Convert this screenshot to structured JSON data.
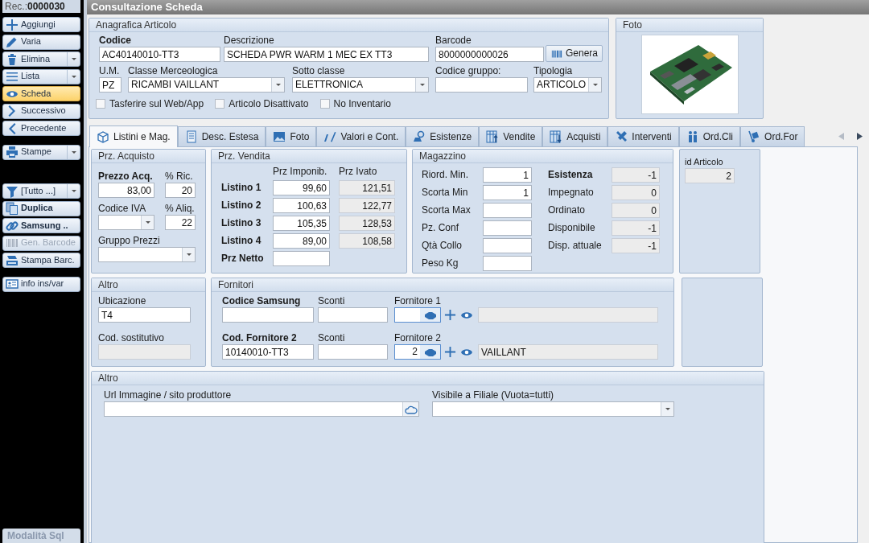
{
  "title": "Consultazione Scheda",
  "sidebar": {
    "record_label": "Rec.:",
    "record_number": "0000030",
    "groups": [
      [
        {
          "label": "Aggiungi",
          "kind": "button",
          "selected": false,
          "disabled": false,
          "bold": false
        },
        {
          "label": "Varia",
          "kind": "button",
          "selected": false,
          "disabled": false,
          "bold": false
        },
        {
          "label": "Elimina",
          "kind": "split",
          "selected": false,
          "disabled": false,
          "bold": false
        },
        {
          "label": "Lista",
          "kind": "split",
          "selected": false,
          "disabled": false,
          "bold": false
        },
        {
          "label": "Scheda",
          "kind": "button",
          "selected": true,
          "disabled": false,
          "bold": false
        },
        {
          "label": "Successivo",
          "kind": "button",
          "selected": false,
          "disabled": false,
          "bold": false
        },
        {
          "label": "Precedente",
          "kind": "button",
          "selected": false,
          "disabled": false,
          "bold": false
        }
      ],
      [
        {
          "label": "Stampe",
          "kind": "split",
          "selected": false,
          "disabled": false,
          "bold": false
        }
      ],
      [
        {
          "label": "[Tutto ...]",
          "kind": "split",
          "selected": false,
          "disabled": false,
          "bold": false
        },
        {
          "label": "Duplica",
          "kind": "button",
          "selected": false,
          "disabled": false,
          "bold": true
        },
        {
          "label": "Samsung ..",
          "kind": "button",
          "selected": false,
          "disabled": false,
          "bold": true
        },
        {
          "label": "Gen. Barcode",
          "kind": "button",
          "selected": false,
          "disabled": true,
          "bold": false
        },
        {
          "label": "Stampa Barc.",
          "kind": "button",
          "selected": false,
          "disabled": false,
          "bold": false
        }
      ],
      [
        {
          "label": "info ins/var",
          "kind": "button",
          "selected": false,
          "disabled": false,
          "bold": false
        }
      ]
    ],
    "mode_button": "Modalità Sql"
  },
  "anagrafica": {
    "title": "Anagrafica Articolo",
    "row1": [
      {
        "label": "Codice",
        "bold": true,
        "value": "AC40140010-TT3",
        "kind": "text"
      },
      {
        "label": "Descrizione",
        "bold": false,
        "value": "SCHEDA PWR WARM 1 MEC EX TT3",
        "kind": "text"
      },
      {
        "label": "Barcode",
        "bold": false,
        "value": "8000000000026",
        "kind": "text"
      }
    ],
    "generate_button": "Genera",
    "row2": [
      {
        "label": "U.M.",
        "bold": false,
        "value": "PZ",
        "kind": "text"
      },
      {
        "label": "Classe Merceologica",
        "bold": false,
        "value": "RICAMBI VAILLANT",
        "kind": "combo"
      },
      {
        "label": "Sotto classe",
        "bold": false,
        "value": "ELETTRONICA",
        "kind": "combo"
      },
      {
        "label": "Codice gruppo:",
        "bold": false,
        "kind": "text"
      },
      {
        "label": "Tipologia",
        "bold": false,
        "value": "ARTICOLO",
        "kind": "combo"
      }
    ],
    "checkboxes": [
      {
        "label": "Tasferire sul Web/App",
        "checked": false
      },
      {
        "label": "Articolo Disattivato",
        "checked": false
      },
      {
        "label": "No Inventario",
        "checked": false
      }
    ]
  },
  "foto": {
    "title": "Foto",
    "kind": "picture"
  },
  "tabs": [
    {
      "label": "Listini e Mag.",
      "selected": true
    },
    {
      "label": "Desc. Estesa",
      "selected": false
    },
    {
      "label": "Foto",
      "selected": false
    },
    {
      "label": "Valori e Cont.",
      "selected": false
    },
    {
      "label": "Esistenze",
      "selected": false
    },
    {
      "label": "Vendite",
      "selected": false
    },
    {
      "label": "Acquisti",
      "selected": false
    },
    {
      "label": "Interventi",
      "selected": false
    },
    {
      "label": "Ord.Cli",
      "selected": false
    },
    {
      "label": "Ord.For",
      "selected": false
    }
  ],
  "purchase": {
    "title": "Prz. Acquisto",
    "fields": [
      {
        "label": "Prezzo Acq.",
        "bold": true,
        "value": "83,00",
        "kind": "number"
      },
      {
        "label": "% Ric.",
        "bold": false,
        "value": "20",
        "kind": "number"
      },
      {
        "label": "Codice IVA",
        "bold": false,
        "kind": "combo"
      },
      {
        "label": "% Aliq.",
        "bold": false,
        "value": "22",
        "kind": "number"
      },
      {
        "label": "Gruppo Prezzi",
        "bold": false,
        "kind": "combo"
      }
    ]
  },
  "sale": {
    "title": "Prz. Vendita",
    "columns": [
      "Prz Imponib.",
      "Prz Ivato"
    ],
    "rows": [
      {
        "label": "Listino 1",
        "taxable": "99,60",
        "vat_field": true,
        "with_vat": "121,51"
      },
      {
        "label": "Listino 2",
        "taxable": "100,63",
        "vat_field": true,
        "with_vat": "122,77"
      },
      {
        "label": "Listino 3",
        "taxable": "105,35",
        "vat_field": true,
        "with_vat": "128,53"
      },
      {
        "label": "Listino 4",
        "taxable": "89,00",
        "vat_field": true,
        "with_vat": "108,58"
      },
      {
        "label": "Prz Netto",
        "vat_field": false
      }
    ]
  },
  "stock": {
    "title": "Magazzino",
    "left": [
      {
        "label": "Riord. Min.",
        "bold": false,
        "value": "1",
        "kind": "number"
      },
      {
        "label": "Scorta Min",
        "bold": false,
        "value": "1",
        "kind": "number"
      },
      {
        "label": "Scorta Max",
        "bold": false,
        "kind": "number"
      },
      {
        "label": "Pz. Conf",
        "bold": false,
        "kind": "number"
      },
      {
        "label": "Qtà Collo",
        "bold": false,
        "kind": "number"
      },
      {
        "label": "Peso Kg",
        "bold": false,
        "kind": "number"
      }
    ],
    "right": [
      {
        "label": "Esistenza",
        "bold": true,
        "value": "-1",
        "kind": "readonly_number"
      },
      {
        "label": "Impegnato",
        "bold": false,
        "value": "0",
        "kind": "readonly_number"
      },
      {
        "label": "Ordinato",
        "bold": false,
        "value": "0",
        "kind": "readonly_number"
      },
      {
        "label": "Disponibile",
        "bold": false,
        "value": "-1",
        "kind": "readonly_number"
      },
      {
        "label": "Disp. attuale",
        "bold": false,
        "value": "-1",
        "kind": "readonly_number"
      }
    ]
  },
  "id_panel": {
    "label": "id Articolo",
    "value": "2"
  },
  "other": {
    "title": "Altro",
    "fields": [
      {
        "label": "Ubicazione",
        "value": "T4",
        "kind": "text"
      },
      {
        "label": "Cod. sostitutivo",
        "kind": "readonly"
      }
    ]
  },
  "suppliers": {
    "title": "Fornitori",
    "rows": [
      {
        "code_label": "Codice Samsung",
        "discount_label": "Sconti",
        "supplier_label": "Fornitore 1"
      },
      {
        "code_label": "Cod. Fornitore 2",
        "code": "10140010-TT3",
        "discount_label": "Sconti",
        "supplier_label": "Fornitore 2",
        "supplier_id": "2",
        "supplier_name": "VAILLANT"
      }
    ]
  },
  "other2": {
    "title": "Altro",
    "url_label": "Url Immagine / sito produttore",
    "branch_label": "Visibile a Filiale (Vuota=tutti)"
  }
}
